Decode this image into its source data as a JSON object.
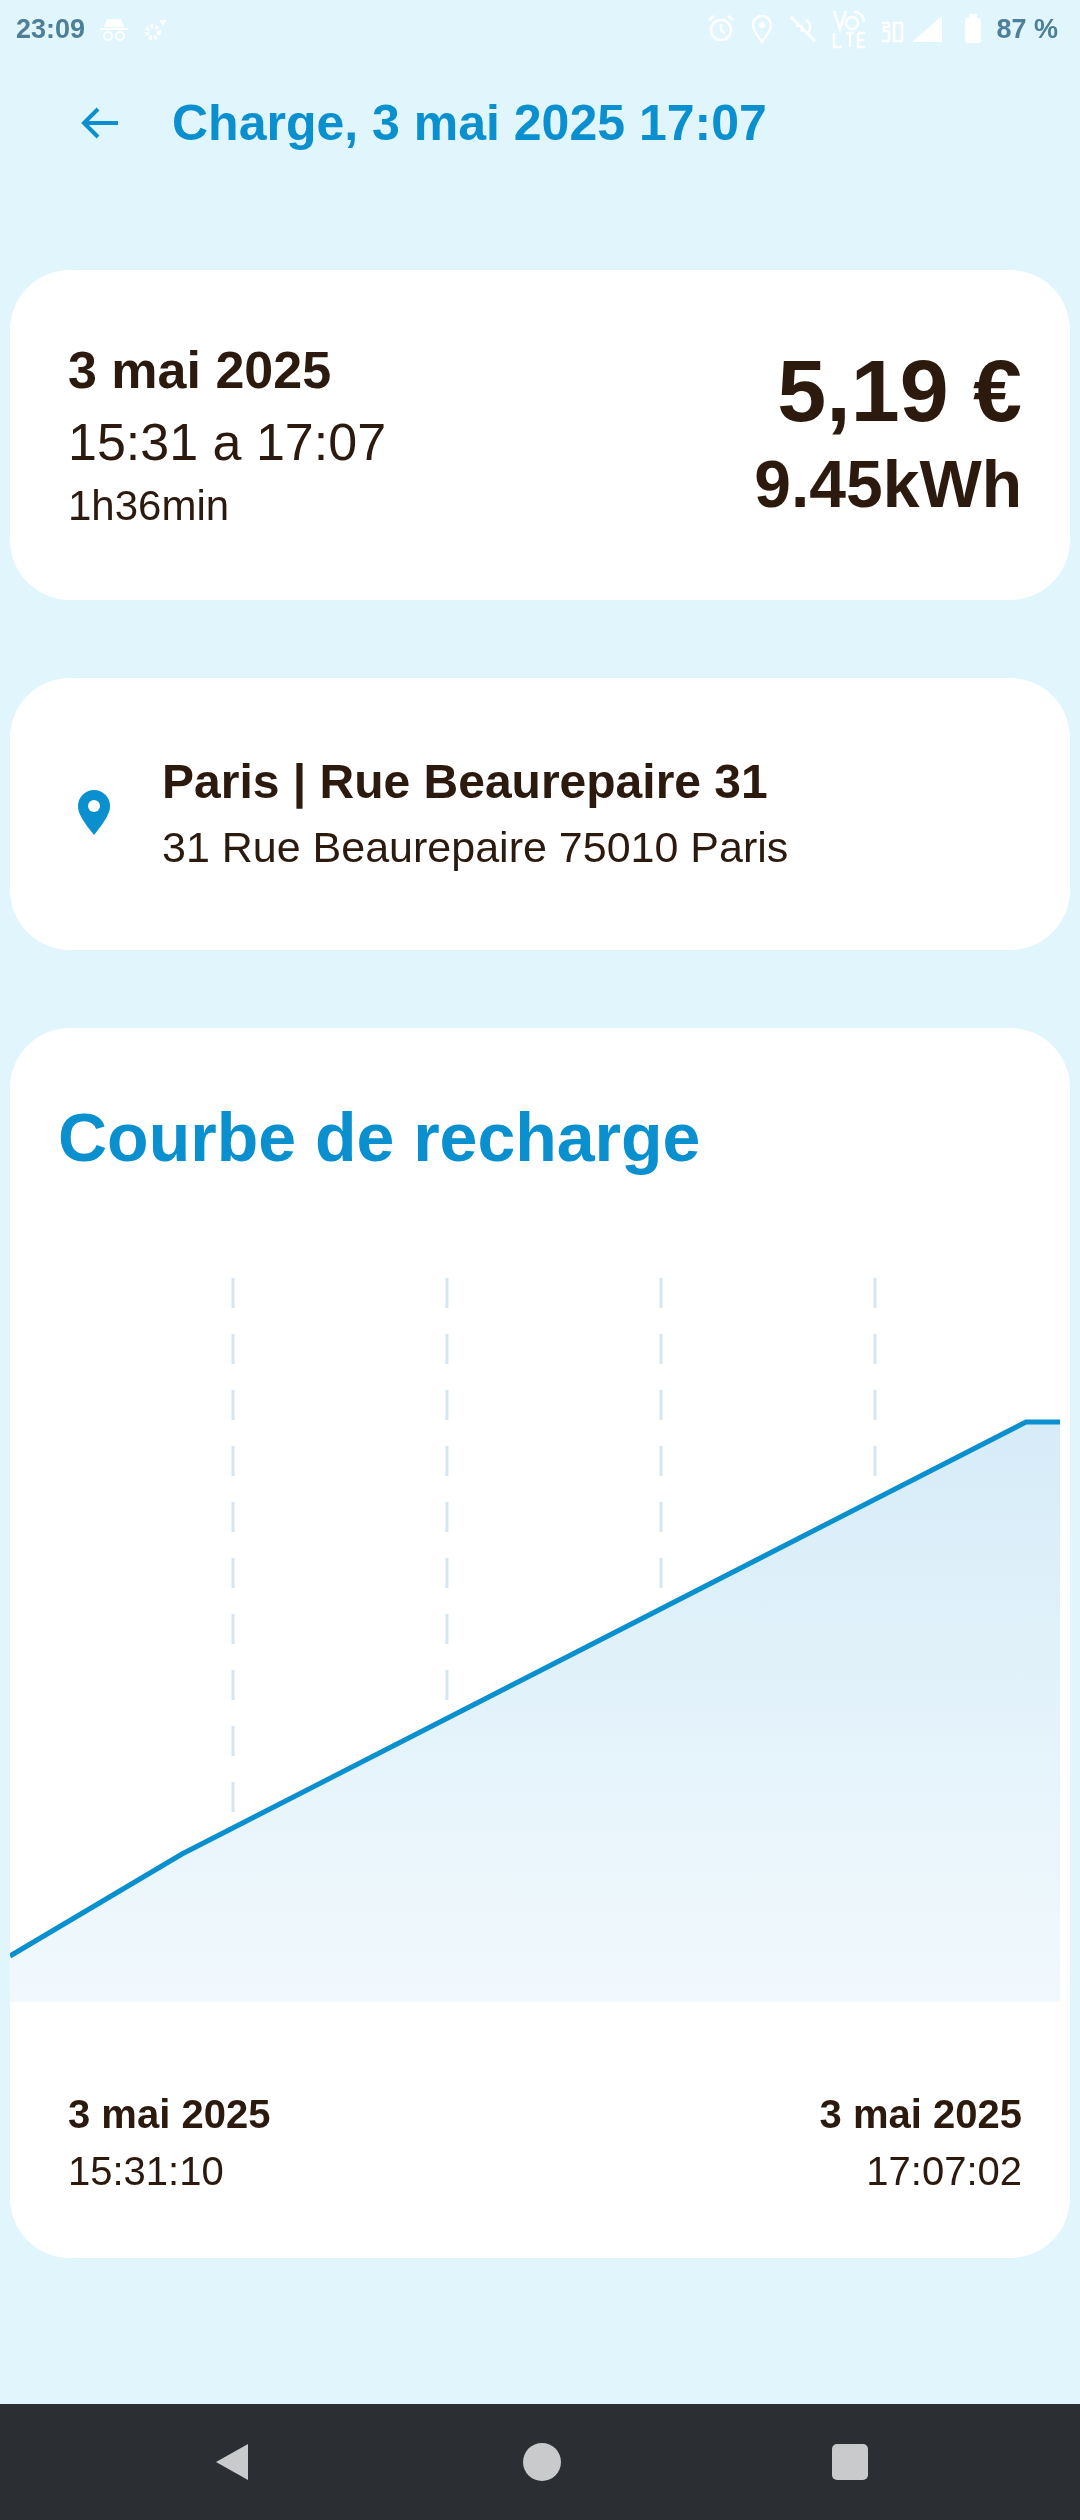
{
  "status_bar": {
    "time": "23:09",
    "battery": "87 %"
  },
  "header": {
    "title": "Charge, 3 mai 2025 17:07"
  },
  "summary": {
    "date": "3 mai 2025",
    "time_range": "15:31 a 17:07",
    "duration": "1h36min",
    "price": "5,19 €",
    "energy": "9.45kWh"
  },
  "location": {
    "name": "Paris | Rue Beaurepaire 31",
    "address": "31 Rue Beaurepaire 75010 Paris"
  },
  "curve": {
    "title": "Courbe de recharge",
    "start": {
      "date": "3 mai 2025",
      "time": "15:31:10"
    },
    "end": {
      "date": "3 mai 2025",
      "time": "17:07:02"
    }
  }
}
